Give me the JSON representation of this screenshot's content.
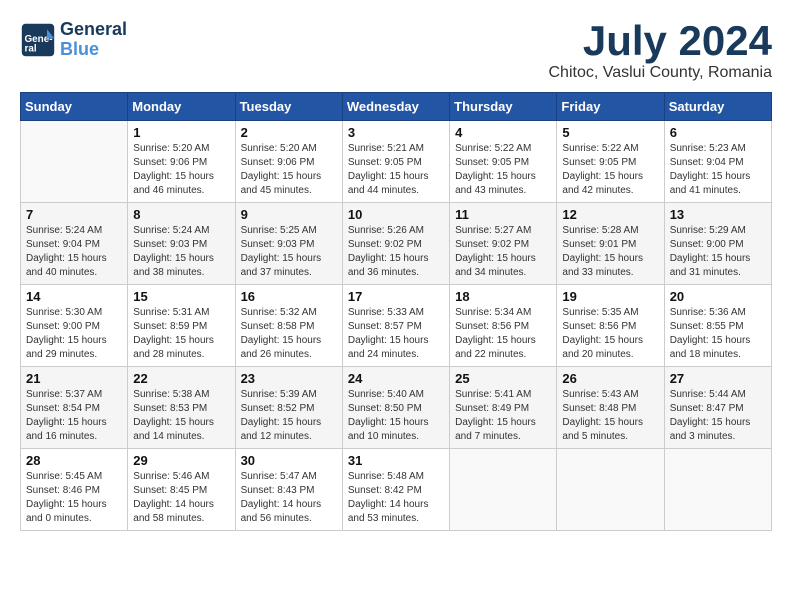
{
  "header": {
    "logo_line1": "General",
    "logo_line2": "Blue",
    "month_year": "July 2024",
    "location": "Chitoc, Vaslui County, Romania"
  },
  "days_of_week": [
    "Sunday",
    "Monday",
    "Tuesday",
    "Wednesday",
    "Thursday",
    "Friday",
    "Saturday"
  ],
  "weeks": [
    [
      {
        "day": "",
        "info": ""
      },
      {
        "day": "1",
        "info": "Sunrise: 5:20 AM\nSunset: 9:06 PM\nDaylight: 15 hours\nand 46 minutes."
      },
      {
        "day": "2",
        "info": "Sunrise: 5:20 AM\nSunset: 9:06 PM\nDaylight: 15 hours\nand 45 minutes."
      },
      {
        "day": "3",
        "info": "Sunrise: 5:21 AM\nSunset: 9:05 PM\nDaylight: 15 hours\nand 44 minutes."
      },
      {
        "day": "4",
        "info": "Sunrise: 5:22 AM\nSunset: 9:05 PM\nDaylight: 15 hours\nand 43 minutes."
      },
      {
        "day": "5",
        "info": "Sunrise: 5:22 AM\nSunset: 9:05 PM\nDaylight: 15 hours\nand 42 minutes."
      },
      {
        "day": "6",
        "info": "Sunrise: 5:23 AM\nSunset: 9:04 PM\nDaylight: 15 hours\nand 41 minutes."
      }
    ],
    [
      {
        "day": "7",
        "info": "Sunrise: 5:24 AM\nSunset: 9:04 PM\nDaylight: 15 hours\nand 40 minutes."
      },
      {
        "day": "8",
        "info": "Sunrise: 5:24 AM\nSunset: 9:03 PM\nDaylight: 15 hours\nand 38 minutes."
      },
      {
        "day": "9",
        "info": "Sunrise: 5:25 AM\nSunset: 9:03 PM\nDaylight: 15 hours\nand 37 minutes."
      },
      {
        "day": "10",
        "info": "Sunrise: 5:26 AM\nSunset: 9:02 PM\nDaylight: 15 hours\nand 36 minutes."
      },
      {
        "day": "11",
        "info": "Sunrise: 5:27 AM\nSunset: 9:02 PM\nDaylight: 15 hours\nand 34 minutes."
      },
      {
        "day": "12",
        "info": "Sunrise: 5:28 AM\nSunset: 9:01 PM\nDaylight: 15 hours\nand 33 minutes."
      },
      {
        "day": "13",
        "info": "Sunrise: 5:29 AM\nSunset: 9:00 PM\nDaylight: 15 hours\nand 31 minutes."
      }
    ],
    [
      {
        "day": "14",
        "info": "Sunrise: 5:30 AM\nSunset: 9:00 PM\nDaylight: 15 hours\nand 29 minutes."
      },
      {
        "day": "15",
        "info": "Sunrise: 5:31 AM\nSunset: 8:59 PM\nDaylight: 15 hours\nand 28 minutes."
      },
      {
        "day": "16",
        "info": "Sunrise: 5:32 AM\nSunset: 8:58 PM\nDaylight: 15 hours\nand 26 minutes."
      },
      {
        "day": "17",
        "info": "Sunrise: 5:33 AM\nSunset: 8:57 PM\nDaylight: 15 hours\nand 24 minutes."
      },
      {
        "day": "18",
        "info": "Sunrise: 5:34 AM\nSunset: 8:56 PM\nDaylight: 15 hours\nand 22 minutes."
      },
      {
        "day": "19",
        "info": "Sunrise: 5:35 AM\nSunset: 8:56 PM\nDaylight: 15 hours\nand 20 minutes."
      },
      {
        "day": "20",
        "info": "Sunrise: 5:36 AM\nSunset: 8:55 PM\nDaylight: 15 hours\nand 18 minutes."
      }
    ],
    [
      {
        "day": "21",
        "info": "Sunrise: 5:37 AM\nSunset: 8:54 PM\nDaylight: 15 hours\nand 16 minutes."
      },
      {
        "day": "22",
        "info": "Sunrise: 5:38 AM\nSunset: 8:53 PM\nDaylight: 15 hours\nand 14 minutes."
      },
      {
        "day": "23",
        "info": "Sunrise: 5:39 AM\nSunset: 8:52 PM\nDaylight: 15 hours\nand 12 minutes."
      },
      {
        "day": "24",
        "info": "Sunrise: 5:40 AM\nSunset: 8:50 PM\nDaylight: 15 hours\nand 10 minutes."
      },
      {
        "day": "25",
        "info": "Sunrise: 5:41 AM\nSunset: 8:49 PM\nDaylight: 15 hours\nand 7 minutes."
      },
      {
        "day": "26",
        "info": "Sunrise: 5:43 AM\nSunset: 8:48 PM\nDaylight: 15 hours\nand 5 minutes."
      },
      {
        "day": "27",
        "info": "Sunrise: 5:44 AM\nSunset: 8:47 PM\nDaylight: 15 hours\nand 3 minutes."
      }
    ],
    [
      {
        "day": "28",
        "info": "Sunrise: 5:45 AM\nSunset: 8:46 PM\nDaylight: 15 hours\nand 0 minutes."
      },
      {
        "day": "29",
        "info": "Sunrise: 5:46 AM\nSunset: 8:45 PM\nDaylight: 14 hours\nand 58 minutes."
      },
      {
        "day": "30",
        "info": "Sunrise: 5:47 AM\nSunset: 8:43 PM\nDaylight: 14 hours\nand 56 minutes."
      },
      {
        "day": "31",
        "info": "Sunrise: 5:48 AM\nSunset: 8:42 PM\nDaylight: 14 hours\nand 53 minutes."
      },
      {
        "day": "",
        "info": ""
      },
      {
        "day": "",
        "info": ""
      },
      {
        "day": "",
        "info": ""
      }
    ]
  ]
}
